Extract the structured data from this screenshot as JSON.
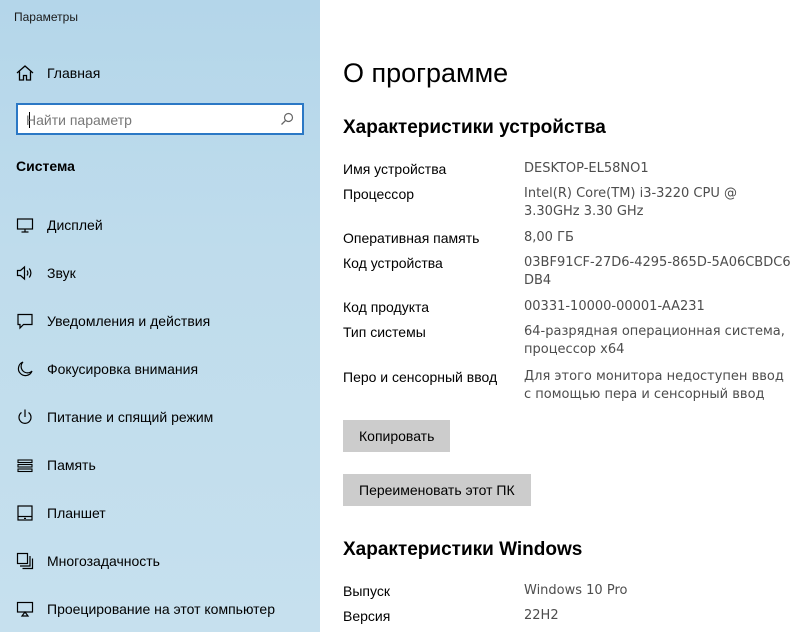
{
  "window": {
    "app_title": "Параметры"
  },
  "sidebar": {
    "home_label": "Главная",
    "search_placeholder": "Найти параметр",
    "section_heading": "Система",
    "items": [
      {
        "label": "Дисплей",
        "icon": "display-icon"
      },
      {
        "label": "Звук",
        "icon": "speaker-icon"
      },
      {
        "label": "Уведомления и действия",
        "icon": "notification-icon"
      },
      {
        "label": "Фокусировка внимания",
        "icon": "moon-icon"
      },
      {
        "label": "Питание и спящий режим",
        "icon": "power-icon"
      },
      {
        "label": "Память",
        "icon": "storage-icon"
      },
      {
        "label": "Планшет",
        "icon": "tablet-icon"
      },
      {
        "label": "Многозадачность",
        "icon": "multitasking-icon"
      },
      {
        "label": "Проецирование на этот компьютер",
        "icon": "projecting-icon"
      }
    ]
  },
  "main": {
    "page_title": "О программе",
    "device_section_title": "Характеристики устройства",
    "device_specs": [
      {
        "key": "Имя устройства",
        "value": "DESKTOP-EL58NO1"
      },
      {
        "key": "Процессор",
        "value": "Intel(R) Core(TM) i3-3220 CPU @ 3.30GHz 3.30 GHz"
      },
      {
        "key": "Оперативная память",
        "value": "8,00 ГБ"
      },
      {
        "key": "Код устройства",
        "value": "03BF91CF-27D6-4295-865D-5A06CBDC6DB4"
      },
      {
        "key": "Код продукта",
        "value": "00331-10000-00001-AA231"
      },
      {
        "key": "Тип системы",
        "value": "64-разрядная операционная система, процессор x64"
      },
      {
        "key": "Перо и сенсорный ввод",
        "value": "Для этого монитора недоступен ввод с помощью пера и сенсорный ввод"
      }
    ],
    "copy_button": "Копировать",
    "rename_button": "Переименовать этот ПК",
    "windows_section_title": "Характеристики Windows",
    "windows_specs": [
      {
        "key": "Выпуск",
        "value": "Windows 10 Pro"
      },
      {
        "key": "Версия",
        "value": "22H2"
      }
    ]
  },
  "colors": {
    "sidebar_bg": "#bfdcec",
    "accent": "#2b78c5",
    "button_bg": "#cccccc",
    "value_text": "#4d4d4d"
  }
}
